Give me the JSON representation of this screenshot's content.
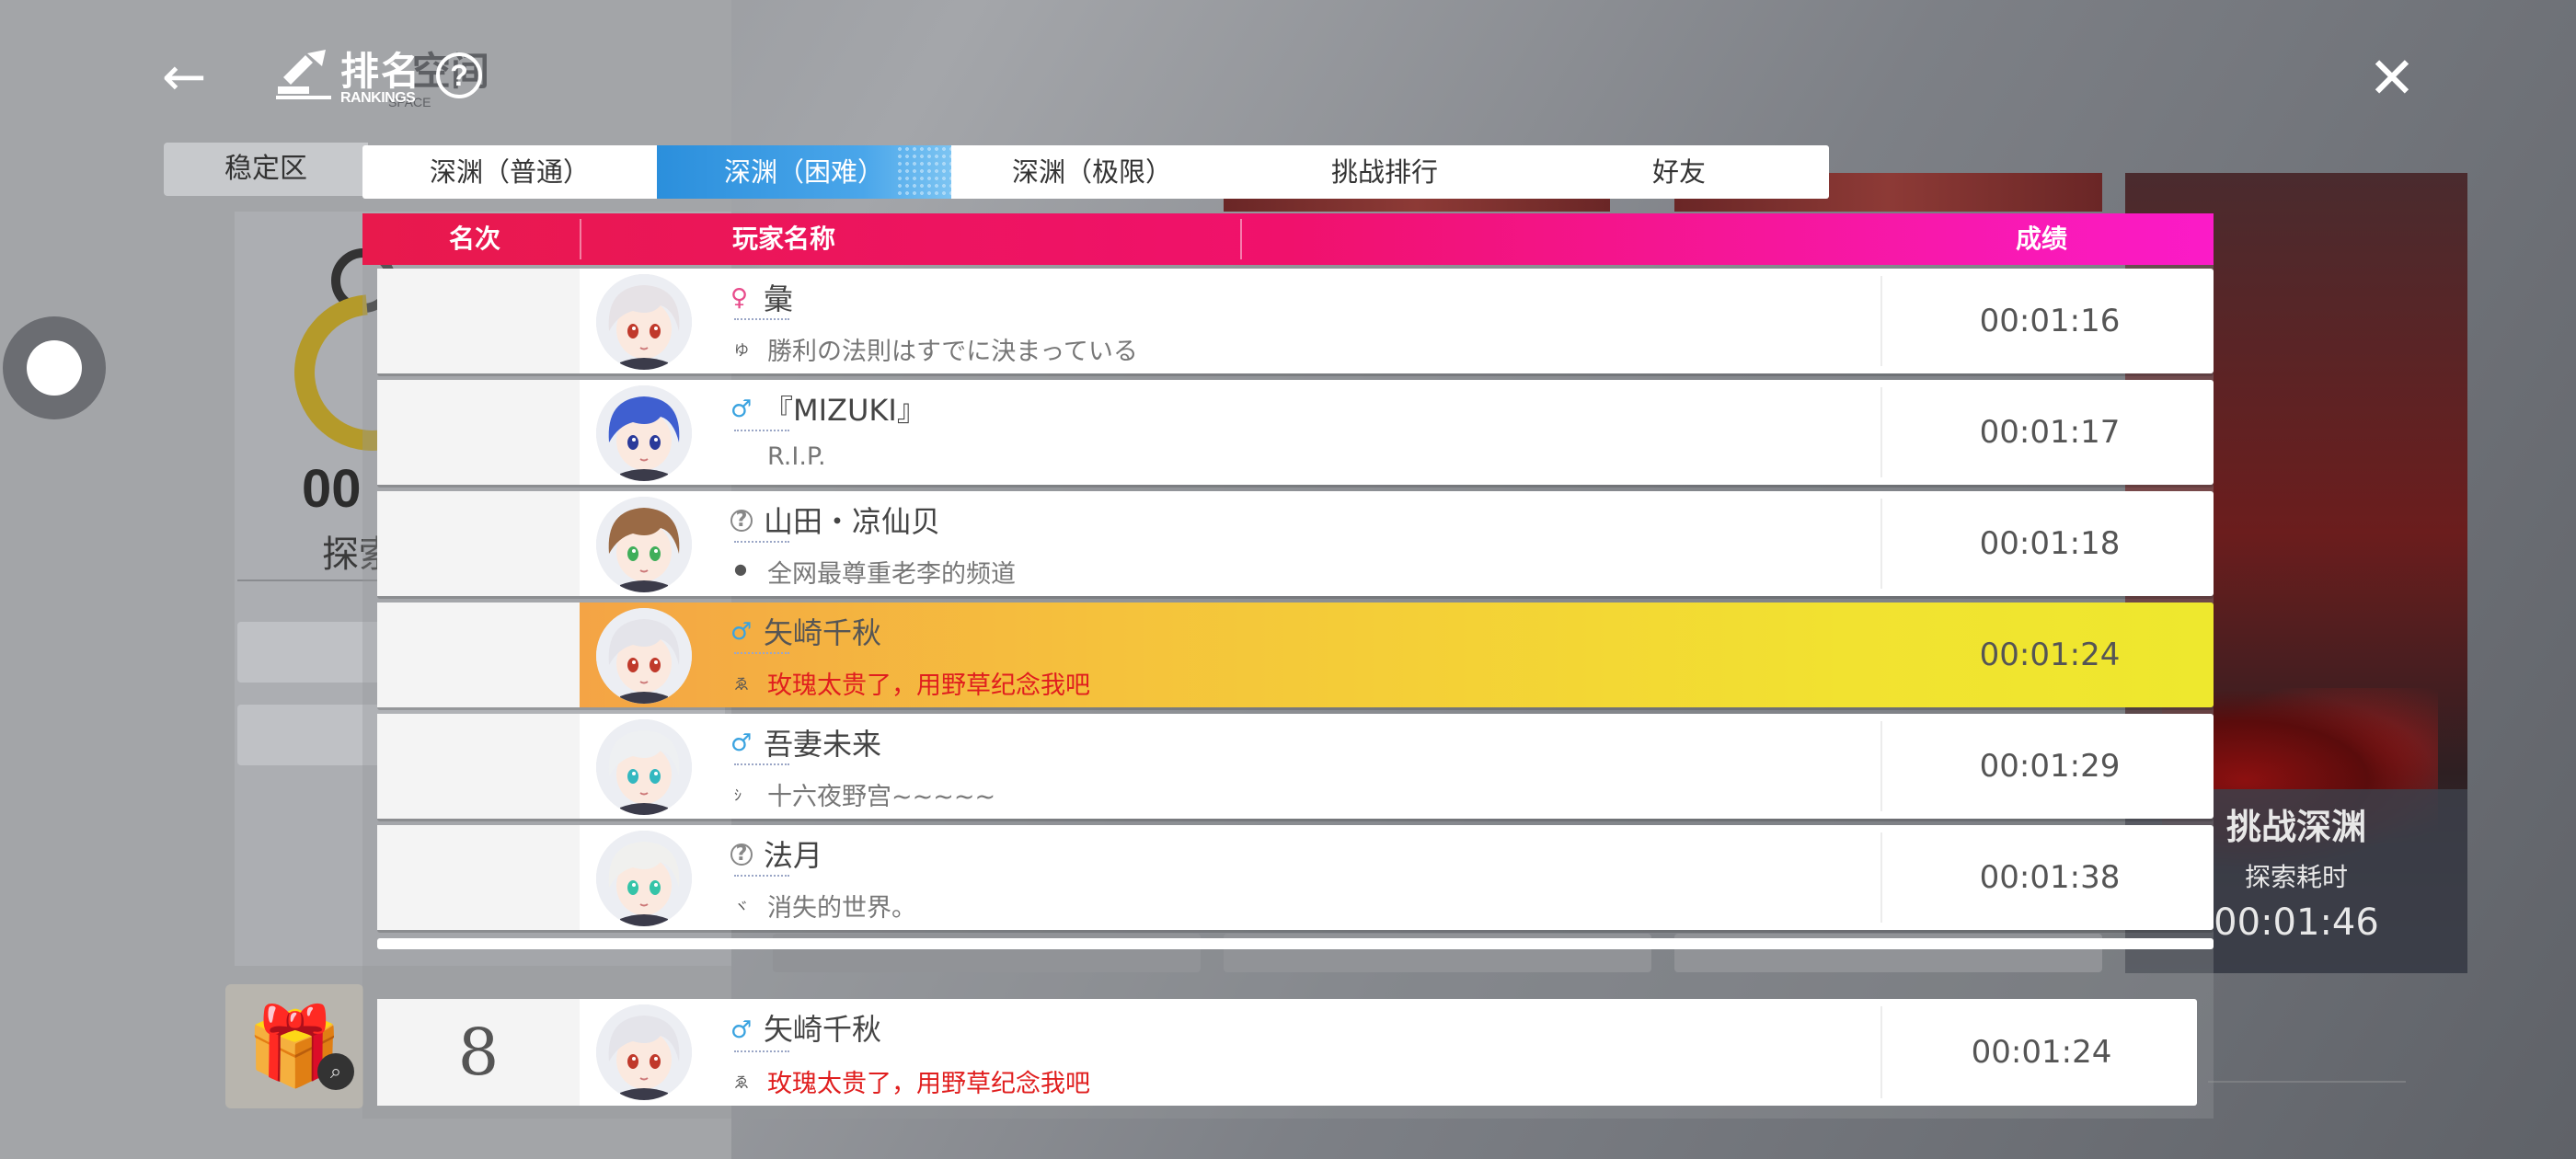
{
  "window": {
    "title_cn": "排名",
    "title_en": "RANKINGS",
    "title_ghost_cn": "空间",
    "title_ghost_en": "SPACE"
  },
  "left_tab": {
    "label": "稳定区"
  },
  "background": {
    "left_value": "00",
    "left_label": "探索",
    "card": {
      "title": "挑战深渊",
      "subtitle": "探索耗时",
      "time": "00:01:46"
    }
  },
  "tabs": [
    {
      "label": "深渊（普通）",
      "active": false
    },
    {
      "label": "深渊（困难）",
      "active": true
    },
    {
      "label": "深渊（极限）",
      "active": false
    },
    {
      "label": "挑战排行",
      "active": false
    },
    {
      "label": "好友",
      "active": false
    }
  ],
  "table": {
    "headers": {
      "rank": "名次",
      "player": "玩家名称",
      "score": "成绩"
    },
    "rows": [
      {
        "rank": "",
        "gender": "♀",
        "gender_type": "f",
        "name": "彙",
        "signature": "勝利の法則はすでに決まっている",
        "signature_icon": "ゆ",
        "score": "00:01:16",
        "highlight": false,
        "avatar_hair": "#e6e2e6",
        "avatar_eye": "#c0392b"
      },
      {
        "rank": "",
        "gender": "♂",
        "gender_type": "m",
        "name": "『MIZUKI』",
        "signature": "R.I.P.",
        "signature_icon": "",
        "score": "00:01:17",
        "highlight": false,
        "avatar_hair": "#3f5fd0",
        "avatar_eye": "#2a3a9a"
      },
      {
        "rank": "",
        "gender": "?",
        "gender_type": "u",
        "name": "山田・凉仙贝",
        "signature": "全网最尊重老李的频道",
        "signature_icon": "●",
        "score": "00:01:18",
        "highlight": false,
        "avatar_hair": "#9a6a45",
        "avatar_eye": "#3fae5a"
      },
      {
        "rank": "",
        "gender": "♂",
        "gender_type": "m",
        "name": "矢崎千秋",
        "signature": "玫瑰太贵了，用野草纪念我吧",
        "signature_icon": "ゑ",
        "score": "00:01:24",
        "highlight": true,
        "avatar_hair": "#e4e4ea",
        "avatar_eye": "#c0392b"
      },
      {
        "rank": "",
        "gender": "♂",
        "gender_type": "m",
        "name": "吾妻未来",
        "signature": "十六夜野宫~~~~~",
        "signature_icon": "ｼ",
        "score": "00:01:29",
        "highlight": false,
        "avatar_hair": "#eef0f2",
        "avatar_eye": "#33b8c0"
      },
      {
        "rank": "",
        "gender": "?",
        "gender_type": "u",
        "name": "法月",
        "signature": "消失的世界。",
        "signature_icon": "ヾ",
        "score": "00:01:38",
        "highlight": false,
        "avatar_hair": "#f0f0ee",
        "avatar_eye": "#35c4a8"
      }
    ],
    "self_row": {
      "rank": "8",
      "gender": "♂",
      "name": "矢崎千秋",
      "signature": "玫瑰太贵了，用野草纪念我吧",
      "signature_icon": "ゑ",
      "score": "00:01:24"
    }
  },
  "icons": {
    "back": "arrow-left-icon",
    "close": "close-icon",
    "help": "help-icon",
    "float": "floating-assistant-icon",
    "gift": "gift-icon",
    "zoom": "zoom-icon"
  },
  "colors": {
    "header_start": "#e8194c",
    "header_end": "#fb1bc8",
    "tab_active": "#2b8fdc",
    "highlight_start": "#f4a445",
    "highlight_end": "#eee82e",
    "signature_red": "#e01e1e"
  },
  "help_glyph": "?",
  "back_glyph": "←",
  "close_glyph": "✕"
}
